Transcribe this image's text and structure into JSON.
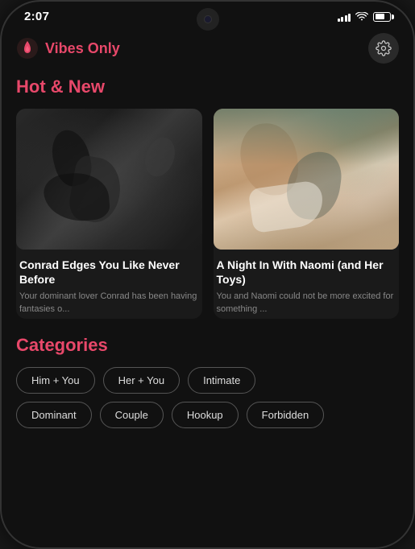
{
  "status_bar": {
    "time": "2:07",
    "signal_bars": [
      4,
      6,
      8,
      10,
      12
    ],
    "wifi": "wifi",
    "battery_level": 70
  },
  "header": {
    "logo_text": "Vibes Only",
    "settings_label": "Settings"
  },
  "hot_new_section": {
    "title": "Hot & New",
    "cards": [
      {
        "title": "Conrad Edges You Like Never Before",
        "description": "Your dominant lover Conrad has been having fantasies o...",
        "image_type": "bw"
      },
      {
        "title": "A Night In With Naomi (and Her Toys)",
        "description": "You and Naomi could not be more excited for something ...",
        "image_type": "color"
      }
    ]
  },
  "categories_section": {
    "title": "Categories",
    "rows": [
      [
        {
          "label": "Him + You"
        },
        {
          "label": "Her + You"
        },
        {
          "label": "Intimate"
        }
      ],
      [
        {
          "label": "Dominant"
        },
        {
          "label": "Couple"
        },
        {
          "label": "Hookup"
        },
        {
          "label": "Forbidden"
        }
      ]
    ]
  }
}
